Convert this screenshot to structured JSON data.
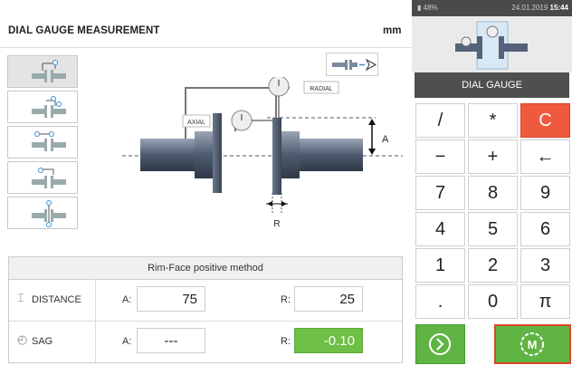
{
  "header": {
    "title": "DIAL GAUGE MEASUREMENT",
    "unit": "mm"
  },
  "diagram": {
    "radial_label": "RADIAL",
    "axial_label": "AXIAL",
    "a_label": "A",
    "r_label": "R"
  },
  "table": {
    "method": "Rim-Face positive method",
    "distance": {
      "label": "DISTANCE",
      "a_label": "A:",
      "a_value": "75",
      "r_label": "R:",
      "r_value": "25"
    },
    "sag": {
      "label": "SAG",
      "a_label": "A:",
      "a_value": "---",
      "r_label": "R:",
      "r_value": "-0.10"
    }
  },
  "status_bar": {
    "battery": "48%",
    "date": "24.01.2019",
    "time": "15:44"
  },
  "mode_label": "DIAL GAUGE",
  "keypad": {
    "rows": [
      [
        "/",
        "*",
        "C"
      ],
      [
        "−",
        "+",
        "←"
      ],
      [
        "7",
        "8",
        "9"
      ],
      [
        "4",
        "5",
        "6"
      ],
      [
        "1",
        "2",
        "3"
      ],
      [
        ".",
        "0",
        "π"
      ]
    ]
  },
  "colors": {
    "accent_green": "#5fb443",
    "clear_red": "#ee5a3d",
    "dark_bar": "#4f4f4f"
  }
}
